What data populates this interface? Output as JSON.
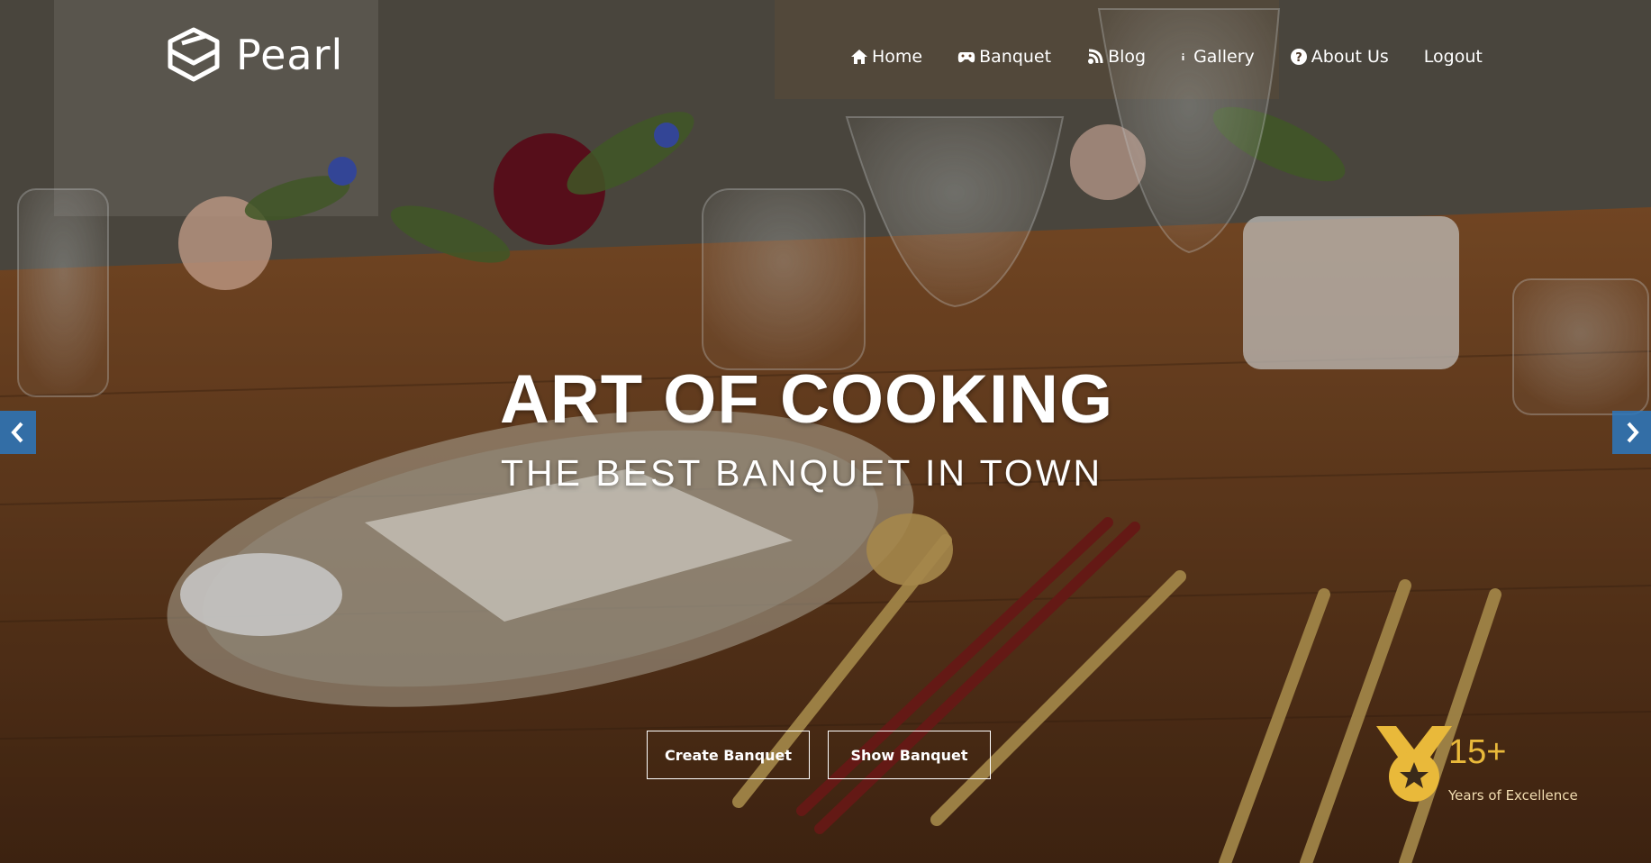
{
  "brand": {
    "name": "Pearl",
    "logo_icon": "stacked-cube-icon"
  },
  "nav": {
    "items": [
      {
        "label": "Home",
        "icon": "home-icon"
      },
      {
        "label": "Banquet",
        "icon": "gamepad-icon"
      },
      {
        "label": "Blog",
        "icon": "blog-icon"
      },
      {
        "label": "Gallery",
        "icon": "info-i-icon"
      },
      {
        "label": "About Us",
        "icon": "question-circle-icon"
      },
      {
        "label": "Logout",
        "icon": ""
      }
    ]
  },
  "hero": {
    "title": "ART OF COOKING",
    "subtitle": "THE BEST BANQUET IN TOWN",
    "buttons": {
      "create": "Create Banquet",
      "show": "Show Banquet"
    },
    "badge": {
      "number": "15+",
      "label": "Years of Excellence",
      "icon": "medal-icon"
    }
  },
  "carousel": {
    "prev_icon": "chevron-left-icon",
    "next_icon": "chevron-right-icon"
  },
  "colors": {
    "accent_gold": "#e9b93a",
    "arrow_blue": "#2c78be"
  }
}
